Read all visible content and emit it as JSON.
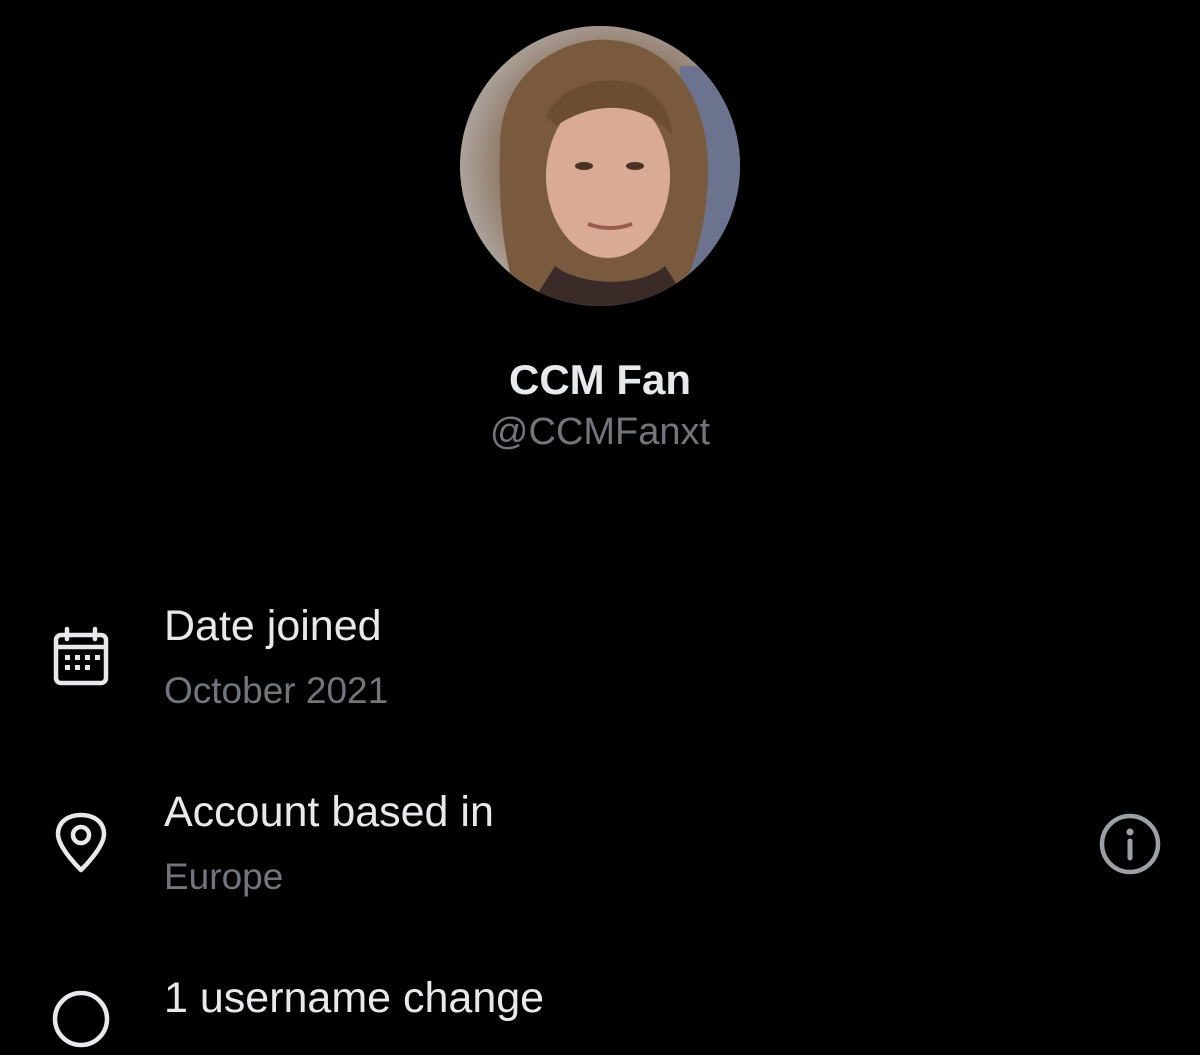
{
  "profile": {
    "display_name": "CCM Fan",
    "handle": "@CCMFanxt"
  },
  "rows": [
    {
      "icon": "calendar-icon",
      "title": "Date joined",
      "subtitle": "October 2021"
    },
    {
      "icon": "location-pin-icon",
      "title": "Account based in",
      "subtitle": "Europe",
      "action_icon": "info-icon"
    },
    {
      "icon": "username-change-icon",
      "title": "1 username change"
    }
  ],
  "colors": {
    "background": "#000000",
    "primary_text": "#e7e9ea",
    "secondary_text": "#71767b"
  }
}
